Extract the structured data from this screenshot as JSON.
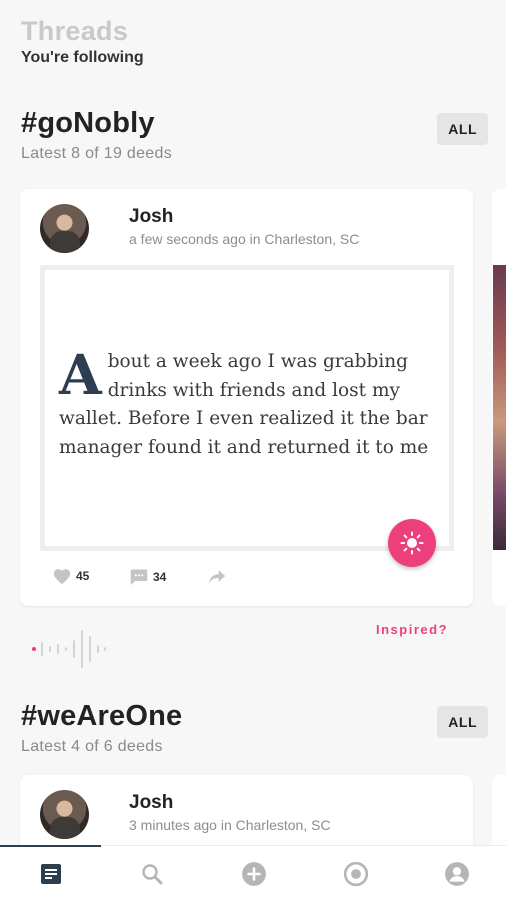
{
  "header": {
    "title": "Threads",
    "subtitle": "You're following"
  },
  "threads": [
    {
      "title": "#goNobly",
      "subtitle": "Latest 8 of 19 deeds",
      "all_label": "ALL",
      "card": {
        "author": "Josh",
        "meta": "a few seconds ago in Charleston, SC",
        "dropcap": "A",
        "text": "bout a week ago I was grabbing drinks with friends and lost my wallet. Before I even realized it the bar manager found it and returned it to me",
        "likes": "45",
        "comments": "34"
      },
      "inspired_label": "Inspired?"
    },
    {
      "title": "#weAreOne",
      "subtitle": "Latest 4 of 6 deeds",
      "all_label": "ALL",
      "card": {
        "author": "Josh",
        "meta": "3 minutes ago in Charleston, SC"
      }
    }
  ],
  "icons": {
    "like": "heart-icon",
    "comment": "comment-icon",
    "share": "share-arrow-icon",
    "inspire": "sun-icon",
    "nav": [
      "feed-icon",
      "search-icon",
      "add-icon",
      "target-icon",
      "profile-icon"
    ]
  },
  "colors": {
    "accent": "#ee3f7d",
    "dark": "#2d3e50",
    "muted": "#8a8a8a"
  }
}
